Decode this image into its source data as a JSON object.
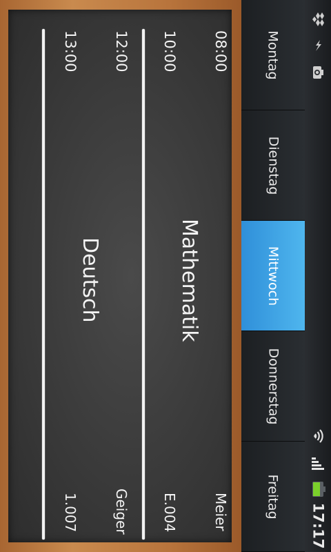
{
  "status_bar": {
    "time": "17:17",
    "icons": [
      "dropbox-icon",
      "usb-debug-icon",
      "camera-icon",
      "wifi-icon",
      "signal-icon",
      "battery-icon"
    ],
    "battery_color": "#7bd12b"
  },
  "tabs": [
    {
      "label": "Montag",
      "active": false
    },
    {
      "label": "Dienstag",
      "active": false
    },
    {
      "label": "Mittwoch",
      "active": true
    },
    {
      "label": "Donnerstag",
      "active": false
    },
    {
      "label": "Freitag",
      "active": false
    }
  ],
  "accent_color": "#4fb6ee",
  "schedule": {
    "periods": [
      {
        "start": "08:00",
        "end": "10:00",
        "subject": "Mathematik",
        "teacher": "Meier",
        "room": "E.004"
      },
      {
        "start": "12:00",
        "end": "13:00",
        "subject": "Deutsch",
        "teacher": "Geiger",
        "room": "1.007"
      }
    ]
  }
}
